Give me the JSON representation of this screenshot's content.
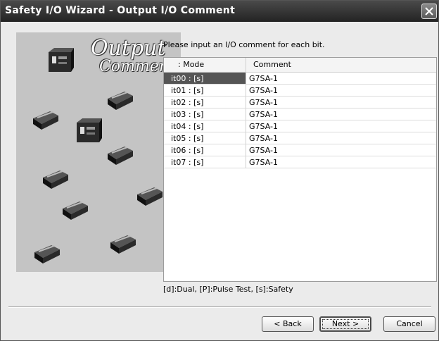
{
  "window": {
    "title": "Safety I/O Wizard - Output I/O Comment"
  },
  "image_panel": {
    "line1": "Output",
    "line2": "Comment"
  },
  "instruction": "Please input an I/O comment for each bit.",
  "table": {
    "columns": [
      ": Mode",
      "Comment"
    ],
    "rows": [
      {
        "mode": "it00 : [s]",
        "comment": "G7SA-1"
      },
      {
        "mode": "it01 : [s]",
        "comment": "G7SA-1"
      },
      {
        "mode": "it02 : [s]",
        "comment": "G7SA-1"
      },
      {
        "mode": "it03 : [s]",
        "comment": "G7SA-1"
      },
      {
        "mode": "it04 : [s]",
        "comment": "G7SA-1"
      },
      {
        "mode": "it05 : [s]",
        "comment": "G7SA-1"
      },
      {
        "mode": "it06 : [s]",
        "comment": "G7SA-1"
      },
      {
        "mode": "it07 : [s]",
        "comment": "G7SA-1"
      }
    ]
  },
  "legend": "[d]:Dual, [P]:Pulse Test, [s]:Safety",
  "buttons": {
    "back": "< Back",
    "next": "Next >",
    "cancel": "Cancel"
  },
  "icons": {
    "close": "close-icon",
    "controller": "controller-device-icon",
    "relay": "relay-device-icon"
  },
  "colors": {
    "titlebar": "#2e2e2e",
    "selection": "#555555"
  }
}
